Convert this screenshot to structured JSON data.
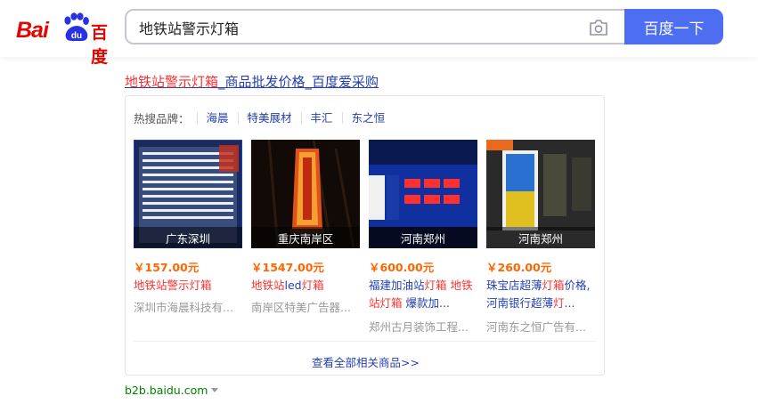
{
  "header": {
    "logo": {
      "latin": "Bai",
      "paw_text": "du",
      "chinese": "百度"
    },
    "search": {
      "value": "地铁站警示灯箱",
      "placeholder": ""
    },
    "search_button_label": "百度一下",
    "icons": {
      "camera": "camera-icon"
    }
  },
  "result": {
    "title_highlight": "地铁站警示灯箱",
    "title_rest": "_商品批发价格_百度爱采购",
    "hot_brands_label": "热搜品牌：",
    "hot_brands": [
      "海晨",
      "特美展材",
      "丰汇",
      "东之恒"
    ],
    "products": [
      {
        "location": "广东深圳",
        "price": "￥157.00元",
        "name_parts": [
          {
            "t": "地铁站警示灯箱",
            "hl": true
          }
        ],
        "company": "深圳市海晨科技有..."
      },
      {
        "location": "重庆南岸区",
        "price": "￥1547.00元",
        "name_parts": [
          {
            "t": "地铁站",
            "hl": true
          },
          {
            "t": "led",
            "hl": false
          },
          {
            "t": "灯箱",
            "hl": true
          }
        ],
        "company": "南岸区特美广告器..."
      },
      {
        "location": "河南郑州",
        "price": "￥600.00元",
        "name_parts": [
          {
            "t": "福建加油站",
            "hl": false
          },
          {
            "t": "灯箱",
            "hl": true
          },
          {
            "t": " ",
            "hl": false
          },
          {
            "t": "地铁站灯箱",
            "hl": true
          },
          {
            "t": " 爆款加...",
            "hl": false
          }
        ],
        "company": "郑州古月装饰工程..."
      },
      {
        "location": "河南郑州",
        "price": "￥260.00元",
        "name_parts": [
          {
            "t": "珠宝店超薄",
            "hl": false
          },
          {
            "t": "灯箱",
            "hl": true
          },
          {
            "t": "价格,河南银行超薄",
            "hl": false
          },
          {
            "t": "灯",
            "hl": true
          },
          {
            "t": "...",
            "hl": false
          }
        ],
        "company": "河南东之恒广告有..."
      }
    ],
    "more_link": "查看全部相关商品>>",
    "source": "b2b.baidu.com"
  },
  "colors": {
    "brand_blue": "#4e6ef2",
    "link": "#2440b3",
    "highlight": "#f73131",
    "price": "#ff6600",
    "source": "#008000"
  }
}
